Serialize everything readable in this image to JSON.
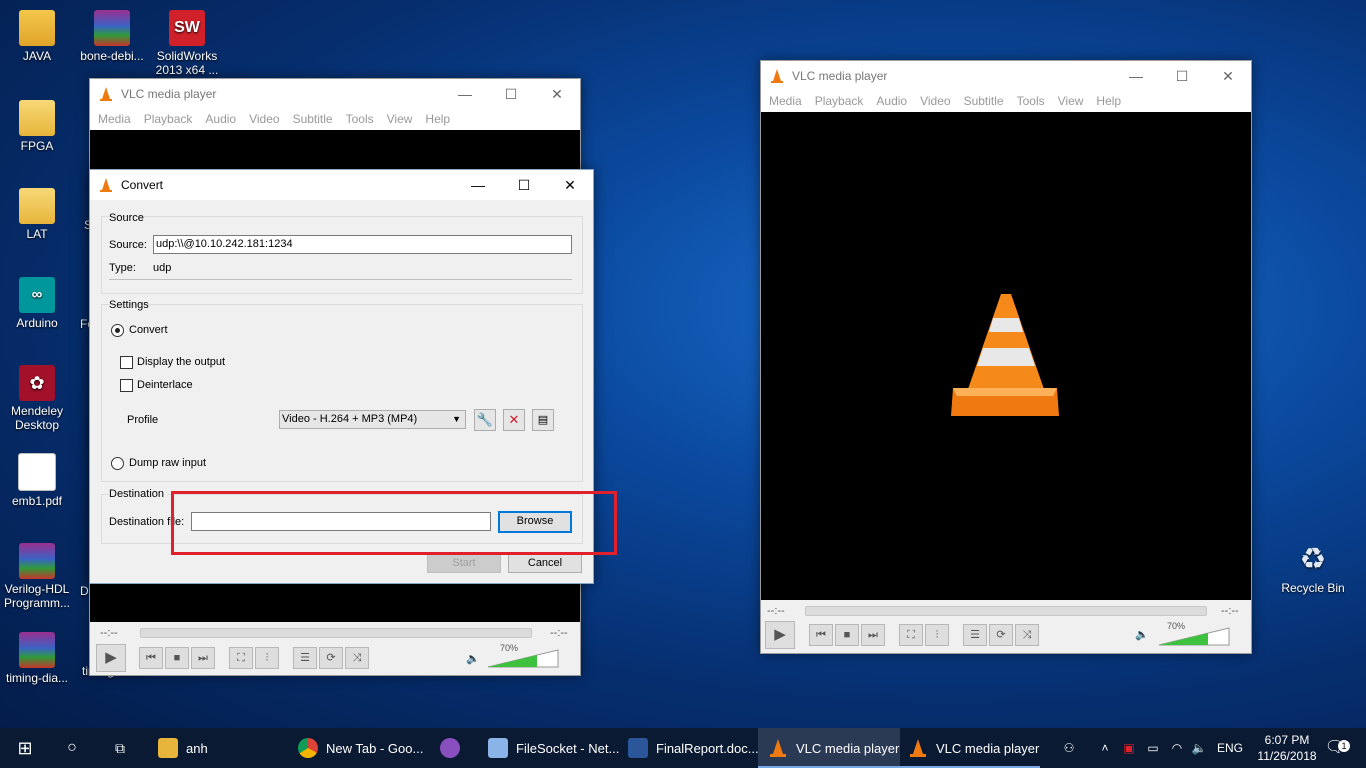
{
  "desktop": {
    "icons": [
      {
        "label": "JAVA",
        "glyph": ""
      },
      {
        "label": "bone-debi...",
        "glyph": ""
      },
      {
        "label": "SolidWorks 2013 x64 ...",
        "glyph": "SW"
      },
      {
        "label": "FPGA",
        "glyph": ""
      },
      {
        "label": "LAT",
        "glyph": ""
      },
      {
        "label": "Arduino",
        "glyph": "∞"
      },
      {
        "label": "Mendeley Desktop",
        "glyph": "✿"
      },
      {
        "label": "emb1.pdf",
        "glyph": ""
      },
      {
        "label": "Verilog-HDL Programm...",
        "glyph": ""
      },
      {
        "label": "timing-dia...",
        "glyph": ""
      },
      {
        "label": "timing-dia...",
        "glyph": ""
      },
      {
        "label": "Recycle Bin",
        "glyph": "♻"
      }
    ],
    "partial_labels": [
      "S",
      "Fo",
      "D"
    ]
  },
  "vlc_back": {
    "title": "VLC media player",
    "menu": [
      "Media",
      "Playback",
      "Audio",
      "Video",
      "Subtitle",
      "Tools",
      "View",
      "Help"
    ],
    "time_elapsed": "--:--",
    "time_total": "--:--",
    "volume_label": "70%",
    "volume": 0.7
  },
  "vlc_right": {
    "title": "VLC media player",
    "menu": [
      "Media",
      "Playback",
      "Audio",
      "Video",
      "Subtitle",
      "Tools",
      "View",
      "Help"
    ],
    "time_elapsed": "--:--",
    "time_total": "--:--",
    "volume_label": "70%",
    "volume": 0.7
  },
  "convert_dialog": {
    "title": "Convert",
    "source_group": "Source",
    "source_label": "Source:",
    "source_value": "udp:\\\\@10.10.242.181:1234",
    "type_label": "Type:",
    "type_value": "udp",
    "settings_group": "Settings",
    "convert_option": "Convert",
    "display_output": "Display the output",
    "deinterlace": "Deinterlace",
    "profile_label": "Profile",
    "profile_value": "Video - H.264 + MP3 (MP4)",
    "dump_raw": "Dump raw input",
    "destination_group": "Destination",
    "destination_label": "Destination file:",
    "destination_value": "",
    "browse": "Browse",
    "start": "Start",
    "cancel": "Cancel"
  },
  "taskbar": {
    "items": [
      {
        "label": "anh"
      },
      {
        "label": "New Tab - Goo..."
      },
      {
        "label": ""
      },
      {
        "label": "FileSocket - Net..."
      },
      {
        "label": "FinalReport.doc..."
      },
      {
        "label": "VLC media player"
      },
      {
        "label": "VLC media player"
      }
    ],
    "language": "ENG",
    "time": "6:07 PM",
    "date": "11/26/2018",
    "notification_count": "1"
  },
  "colors": {
    "highlight_box": "#e0202a",
    "vlc_orange": "#f07a12",
    "accent": "#0078d7"
  }
}
